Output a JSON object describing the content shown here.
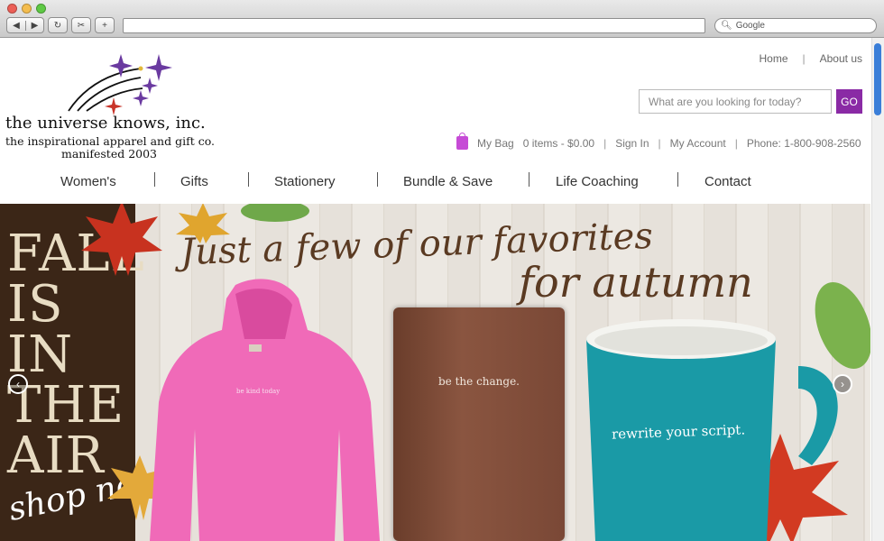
{
  "browser": {
    "search_placeholder": "Google"
  },
  "header": {
    "logo_line1": "the universe knows, inc.",
    "logo_line2": "the inspirational apparel and gift co.",
    "logo_line3": "manifested 2003",
    "top_links": [
      "Home",
      "About us"
    ],
    "search_placeholder": "What are you looking for today?",
    "search_button": "GO",
    "bag_label": "My Bag",
    "bag_summary": "0 items - $0.00",
    "sign_in": "Sign In",
    "my_account": "My Account",
    "phone": "Phone: 1-800-908-2560"
  },
  "nav": {
    "items": [
      "Women's",
      "Gifts",
      "Stationery",
      "Bundle & Save",
      "Life Coaching",
      "Contact"
    ]
  },
  "hero": {
    "side_text": "FALL IS IN THE AIR",
    "shop_text": "shop now!",
    "headline_1": "Just a few of our favorites",
    "headline_2": "for autumn",
    "hoodie_text": "be kind today",
    "notebook_text": "be the change.",
    "mug_text": "rewrite your script."
  },
  "colors": {
    "accent": "#8a2aa5",
    "hoodie": "#f06ab8",
    "mug": "#1a9aa6",
    "notebook": "#7a4836"
  }
}
